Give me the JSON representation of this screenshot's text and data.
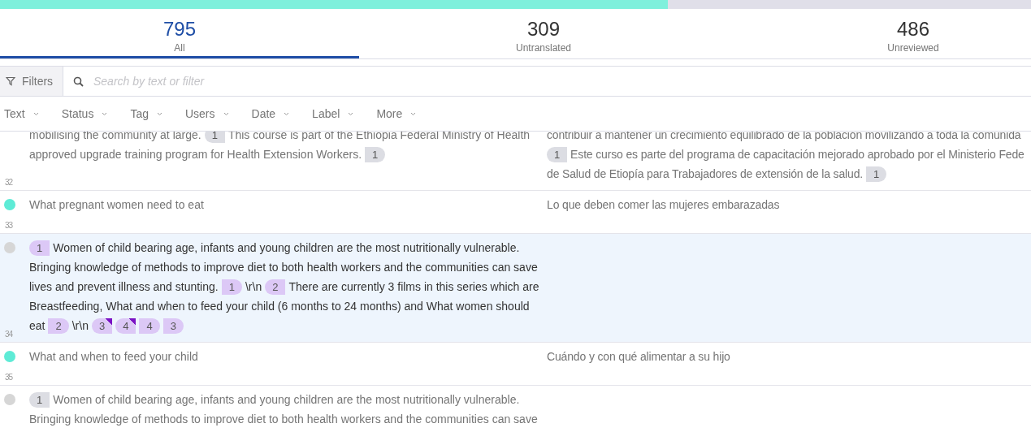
{
  "progress": {
    "level": 0.648
  },
  "tabs": [
    {
      "count": "795",
      "label": "All",
      "selected": true
    },
    {
      "count": "309",
      "label": "Untranslated",
      "selected": false
    },
    {
      "count": "486",
      "label": "Unreviewed",
      "selected": false
    }
  ],
  "filter_button": "Filters",
  "search": {
    "placeholder": "Search by text or filter"
  },
  "filters": [
    "Text",
    "Status",
    "Tag",
    "Users",
    "Date",
    "Label",
    "More"
  ],
  "rows": [
    {
      "number": "32",
      "selected": false,
      "source": [
        [
          {
            "kind": "text",
            "text": "mobilising the community at large."
          },
          {
            "kind": "tag",
            "text": "1",
            "closing": false,
            "flagged": false
          },
          {
            "kind": "text",
            "text": "This course is part of the Ethiopia Federal Ministry of Health"
          }
        ],
        [
          {
            "kind": "text",
            "text": "approved upgrade training program for Health Extension Workers."
          },
          {
            "kind": "tag",
            "text": "1",
            "closing": true,
            "flagged": false
          }
        ]
      ],
      "target": [
        [
          {
            "kind": "text",
            "text": "contribuir a mantener un crecimiento equilibrado de la población movilizando a toda la comunida"
          }
        ],
        [
          {
            "kind": "tag",
            "text": "1",
            "closing": false,
            "flagged": false
          },
          {
            "kind": "text",
            "text": "Este curso es parte del programa de capacitación mejorado aprobado por el Ministerio Fede"
          }
        ],
        [
          {
            "kind": "text",
            "text": "de Salud de Etiopía para Trabajadores de extensión de la salud."
          },
          {
            "kind": "tag",
            "text": "1",
            "closing": true,
            "flagged": false
          }
        ]
      ]
    },
    {
      "number": "33",
      "translated": true,
      "selected": false,
      "source": [
        [
          {
            "kind": "text",
            "text": "What pregnant women need to eat"
          }
        ]
      ],
      "target": [
        [
          {
            "kind": "text",
            "text": "Lo que deben comer las mujeres embarazadas"
          }
        ]
      ]
    },
    {
      "number": "34",
      "translated": false,
      "selected": true,
      "source": [
        [
          {
            "kind": "tag",
            "text": "1",
            "closing": false,
            "flagged": false
          },
          {
            "kind": "text",
            "text": "Women of child bearing age, infants and young children are the most nutritionally vulnerable."
          }
        ],
        [
          {
            "kind": "text",
            "text": "Bringing knowledge of methods to improve diet to both health workers and the communities can save"
          }
        ],
        [
          {
            "kind": "text",
            "text": "lives and prevent illness and stunting."
          },
          {
            "kind": "tag",
            "text": "1",
            "closing": true,
            "flagged": false
          },
          {
            "kind": "text",
            "text": "\\r\\n"
          },
          {
            "kind": "tag",
            "text": "2",
            "closing": false,
            "flagged": false
          },
          {
            "kind": "text",
            "text": "There are currently 3 films in this series which are"
          }
        ],
        [
          {
            "kind": "text",
            "text": "Breastfeeding, What and when to feed your child (6 months to 24 months) and What women should"
          }
        ],
        [
          {
            "kind": "text",
            "text": "eat"
          },
          {
            "kind": "tag",
            "text": "2",
            "closing": true,
            "flagged": false
          },
          {
            "kind": "text",
            "text": "\\r\\n"
          },
          {
            "kind": "tag",
            "text": "3",
            "closing": false,
            "flagged": true
          },
          {
            "kind": "tag",
            "text": "4",
            "closing": false,
            "flagged": true
          },
          {
            "kind": "tag",
            "text": "4",
            "closing": true,
            "flagged": false
          },
          {
            "kind": "tag",
            "text": "3",
            "closing": true,
            "flagged": false
          }
        ]
      ],
      "target": []
    },
    {
      "number": "35",
      "translated": true,
      "selected": false,
      "source": [
        [
          {
            "kind": "text",
            "text": "What and when to feed your child"
          }
        ]
      ],
      "target": [
        [
          {
            "kind": "text",
            "text": "Cuándo y con qué alimentar a su hijo"
          }
        ]
      ]
    },
    {
      "translated": false,
      "selected": false,
      "source": [
        [
          {
            "kind": "tag",
            "text": "1",
            "closing": false,
            "flagged": false
          },
          {
            "kind": "text",
            "text": "Women of child bearing age, infants and young children are the most nutritionally vulnerable."
          }
        ],
        [
          {
            "kind": "text",
            "text": "Bringing knowledge of methods to improve diet to both health workers and the communities can save"
          }
        ]
      ],
      "target": []
    }
  ]
}
